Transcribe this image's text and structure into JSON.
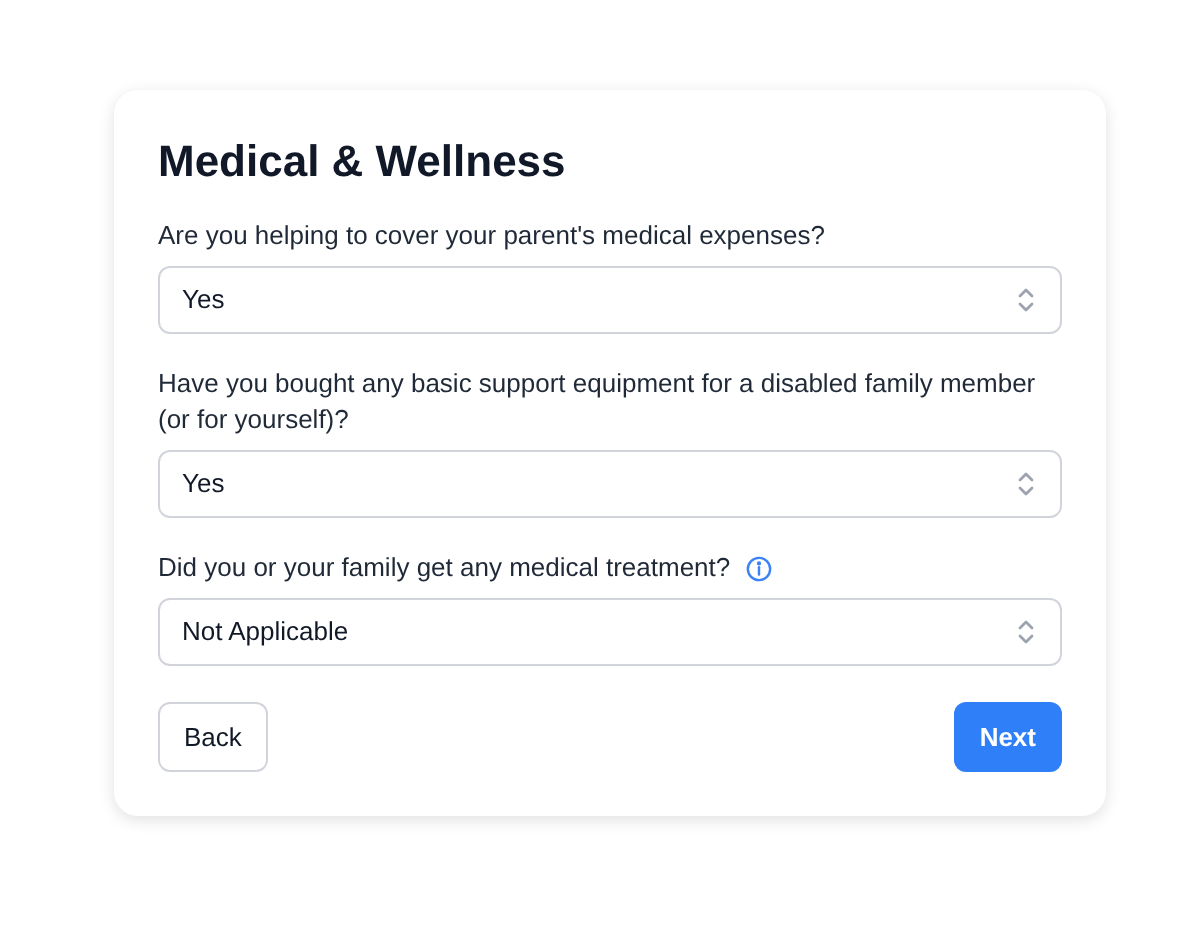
{
  "title": "Medical & Wellness",
  "questions": [
    {
      "label": "Are you helping to cover your parent's medical expenses?",
      "value": "Yes",
      "info": false
    },
    {
      "label": "Have you bought any basic support equipment for a disabled family member (or for yourself)?",
      "value": "Yes",
      "info": false
    },
    {
      "label": "Did you or your family get any medical treatment?",
      "value": "Not Applicable",
      "info": true
    }
  ],
  "buttons": {
    "back": "Back",
    "next": "Next"
  }
}
